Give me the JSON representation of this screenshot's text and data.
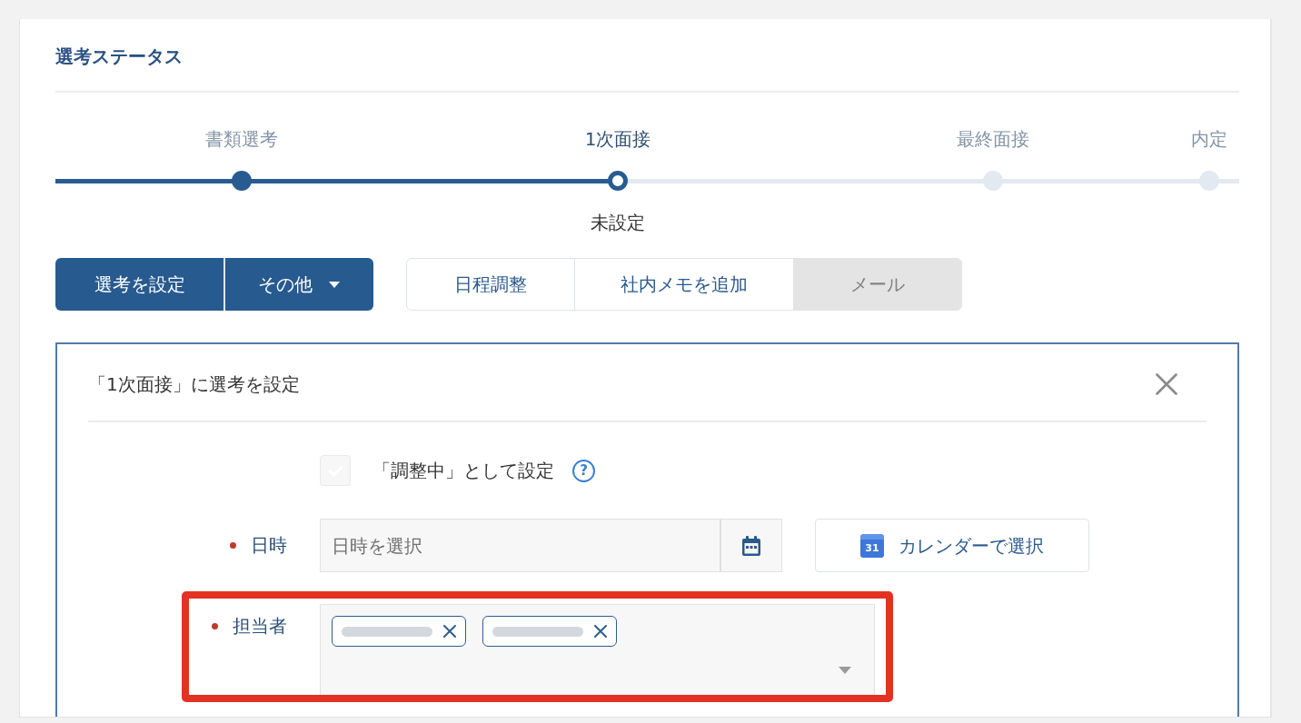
{
  "title": "選考ステータス",
  "steps": [
    {
      "label": "書類選考",
      "done": true,
      "current": false
    },
    {
      "label": "1次面接",
      "done": false,
      "current": true,
      "note": "未設定"
    },
    {
      "label": "最終面接",
      "done": false,
      "current": false
    },
    {
      "label": "内定",
      "done": false,
      "current": false
    }
  ],
  "primary_actions": [
    {
      "label": "選考を設定",
      "kind": "button"
    },
    {
      "label": "その他",
      "kind": "dropdown"
    }
  ],
  "secondary_actions": [
    {
      "label": "日程調整",
      "disabled": false
    },
    {
      "label": "社内メモを追加",
      "disabled": false
    },
    {
      "label": "メール",
      "disabled": true
    }
  ],
  "form": {
    "title": "「1次面接」に選考を設定",
    "pending_option": {
      "label": "「調整中」として設定",
      "checked": false,
      "disabled": true,
      "help": "?"
    },
    "date_field": {
      "label": "日時",
      "required": true,
      "placeholder": "日時を選択"
    },
    "calendar_button": {
      "label": "カレンダーで選択",
      "icon_text": "31"
    },
    "assignee_field": {
      "label": "担当者",
      "required": true,
      "highlighted": true,
      "tags": [
        {
          "blurred": true
        },
        {
          "blurred": true
        }
      ]
    }
  }
}
